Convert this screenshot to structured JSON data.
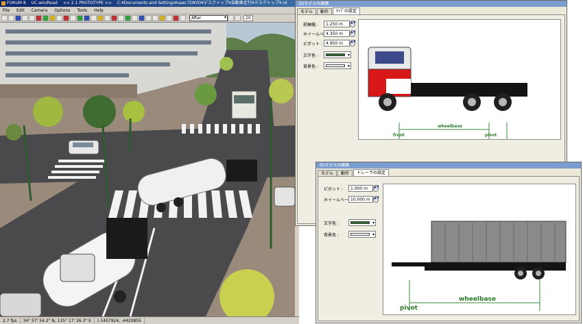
{
  "app": {
    "title_segments": [
      "FORUM 8",
      "UC-win/Road",
      "<< 2.1 PROTOTYPE >>",
      "C:¥Documents and Settings¥user.TOKYO¥デスクトップ¥自動車走行¥デスクトップ¥.rd"
    ],
    "menu": [
      "File",
      "Edit",
      "Camera",
      "Options",
      "Tools",
      "Help"
    ],
    "toolbar": {
      "view_select": "After",
      "view_number": "20"
    },
    "status": {
      "fps": "2.7 fps",
      "coords": "34° 57' 54.2\" N, 135° 17' 26.3\" E",
      "extra": "(-1457924, -4420855"
    }
  },
  "dialog1": {
    "title": "3Dモデルの編集",
    "tabs": [
      "モデル",
      "動作",
      "ｷｬﾌﾞの設定"
    ],
    "active_tab": 2,
    "fields": [
      {
        "label": "前軸幅 :",
        "value": "1.250 m"
      },
      {
        "label": "ホイールベース :",
        "value": "4.350 m"
      },
      {
        "label": "ピボット :",
        "value": "4.950 m"
      }
    ],
    "colors": [
      {
        "label": "文字色 :",
        "color": "#2f6b2f"
      },
      {
        "label": "背景色 :",
        "color": "#ffffff"
      }
    ],
    "diagram_labels": {
      "front": "front",
      "wheelbase": "wheelbase",
      "pivot": "pivot"
    }
  },
  "dialog2": {
    "title": "3Dモデルの編集",
    "tabs": [
      "モデル",
      "動作",
      "トレーラの設定"
    ],
    "active_tab": 2,
    "fields": [
      {
        "label": "ピボット :",
        "value": "1.000 m"
      },
      {
        "label": "ホイールベース :",
        "value": "10.000 m"
      }
    ],
    "colors": [
      {
        "label": "文字色 :",
        "color": "#2f6b2f"
      },
      {
        "label": "背景色 :",
        "color": "#ffffff"
      }
    ],
    "diagram_labels": {
      "pivot": "pivot",
      "wheelbase": "wheelbase"
    }
  }
}
